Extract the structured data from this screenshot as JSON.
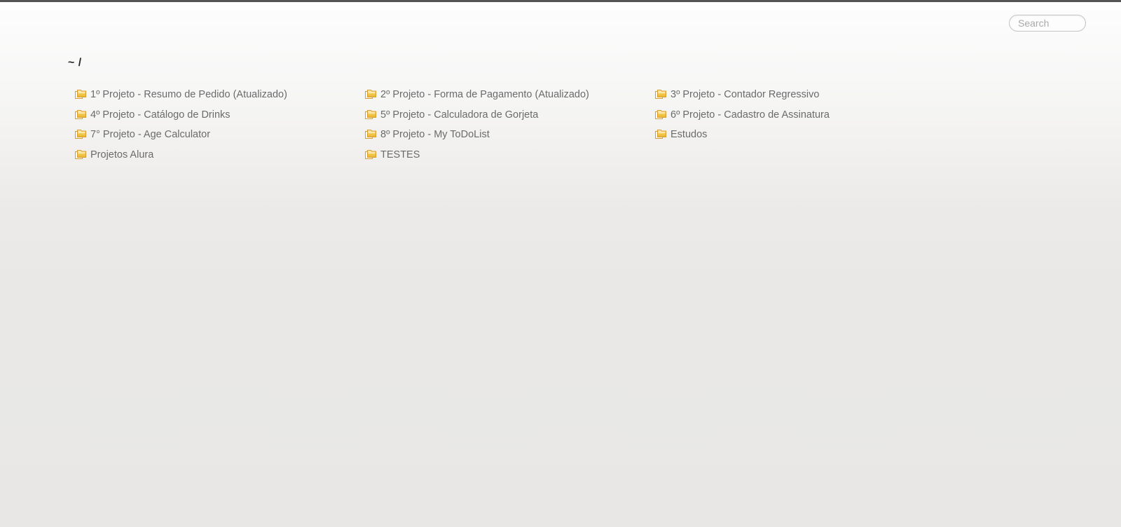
{
  "window": {
    "background_top_color": "#fdfdfd",
    "background_bottom_color": "#e8e7e5",
    "chrome_strip_color": "#555455"
  },
  "search": {
    "placeholder": "Search",
    "value": "",
    "icon": "search-icon"
  },
  "breadcrumb": {
    "home": "~",
    "separator": "/",
    "full_text": "~ /"
  },
  "listing": {
    "icon": "folder-icon",
    "icon_color": "#f2c94c",
    "icon_border_color": "#d99b2b",
    "link_color": "#6b6b6b",
    "columns": [
      {
        "entries": [
          {
            "name": "1º Projeto - Resumo de Pedido (Atualizado)"
          },
          {
            "name": "4º Projeto - Catálogo de Drinks"
          },
          {
            "name": "7° Projeto - Age Calculator"
          },
          {
            "name": "Projetos Alura"
          }
        ]
      },
      {
        "entries": [
          {
            "name": "2º Projeto - Forma de Pagamento (Atualizado)"
          },
          {
            "name": "5º Projeto - Calculadora de Gorjeta"
          },
          {
            "name": "8º Projeto - My ToDoList"
          },
          {
            "name": "TESTES"
          }
        ]
      },
      {
        "entries": [
          {
            "name": "3º Projeto - Contador Regressivo"
          },
          {
            "name": "6º Projeto - Cadastro de Assinatura"
          },
          {
            "name": "Estudos"
          }
        ]
      }
    ]
  }
}
